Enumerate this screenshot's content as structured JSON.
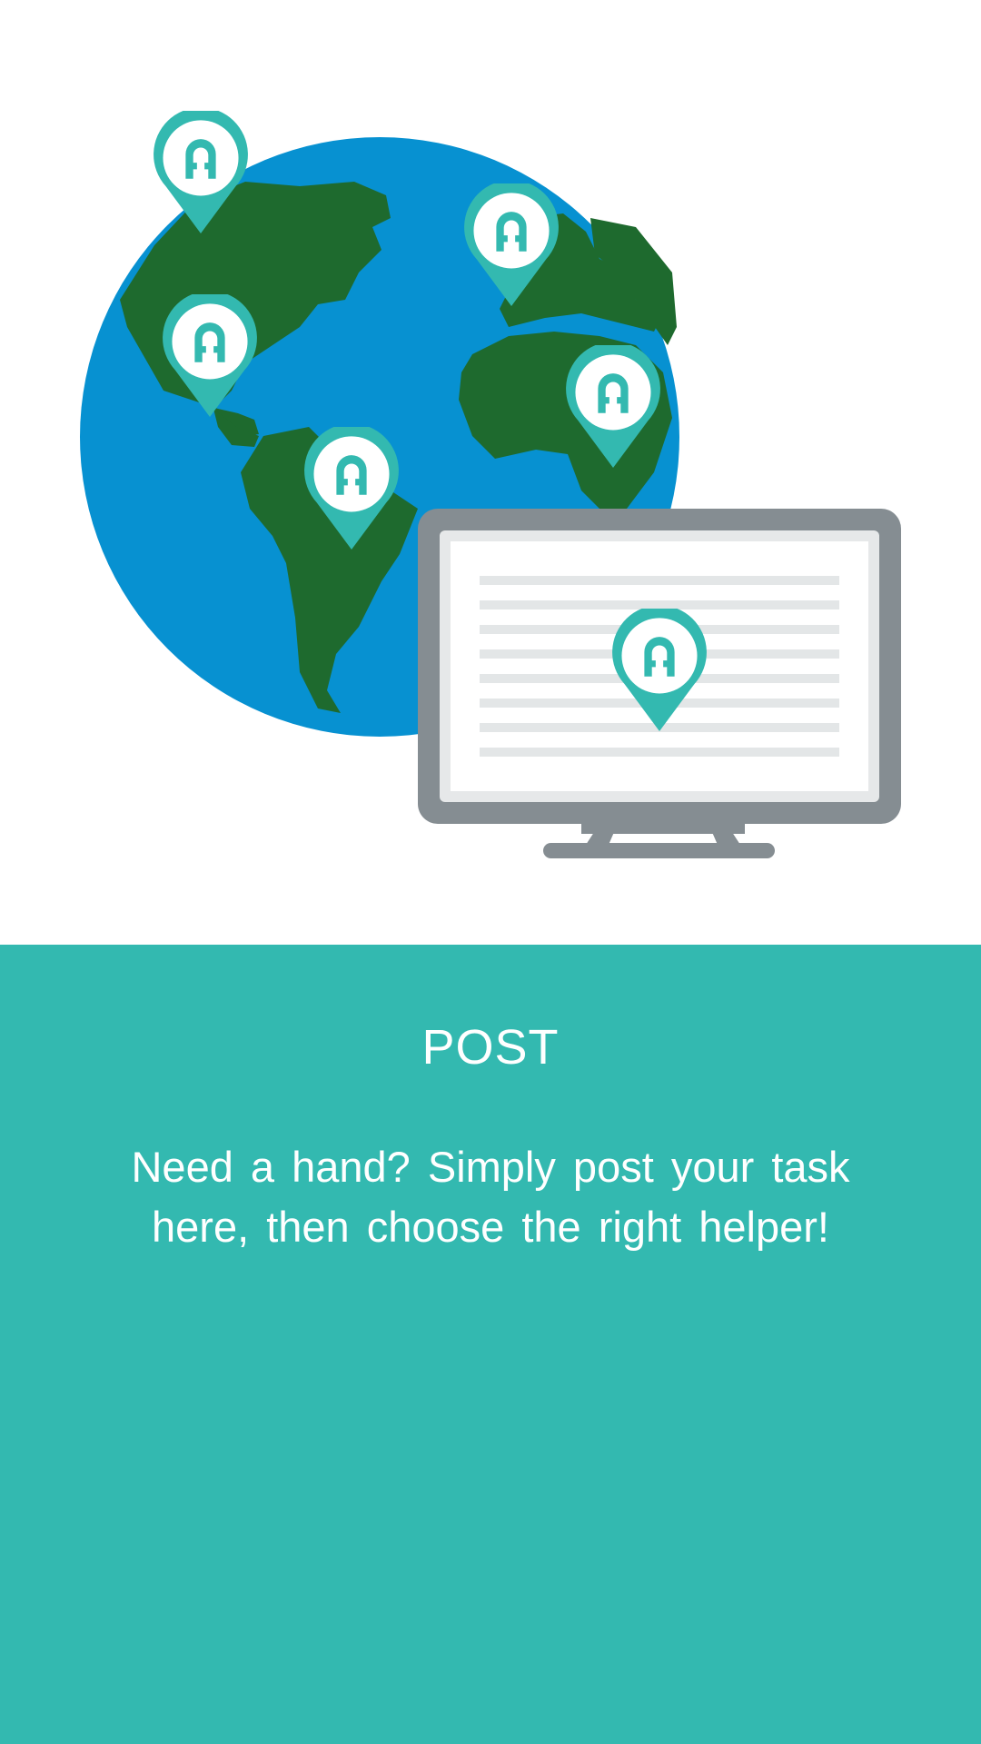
{
  "onboarding": {
    "title": "POST",
    "description": "Need a hand? Simply post your task here, then choose the right helper!"
  },
  "illustration": {
    "globe_icon": "globe-icon",
    "monitor_icon": "monitor-icon",
    "pin_icon": "map-pin-icon",
    "pin_count": 6
  },
  "colors": {
    "accent": "#33b9b0",
    "ocean": "#0791d1",
    "land": "#1e6a2e",
    "monitor_frame": "#858d92"
  }
}
